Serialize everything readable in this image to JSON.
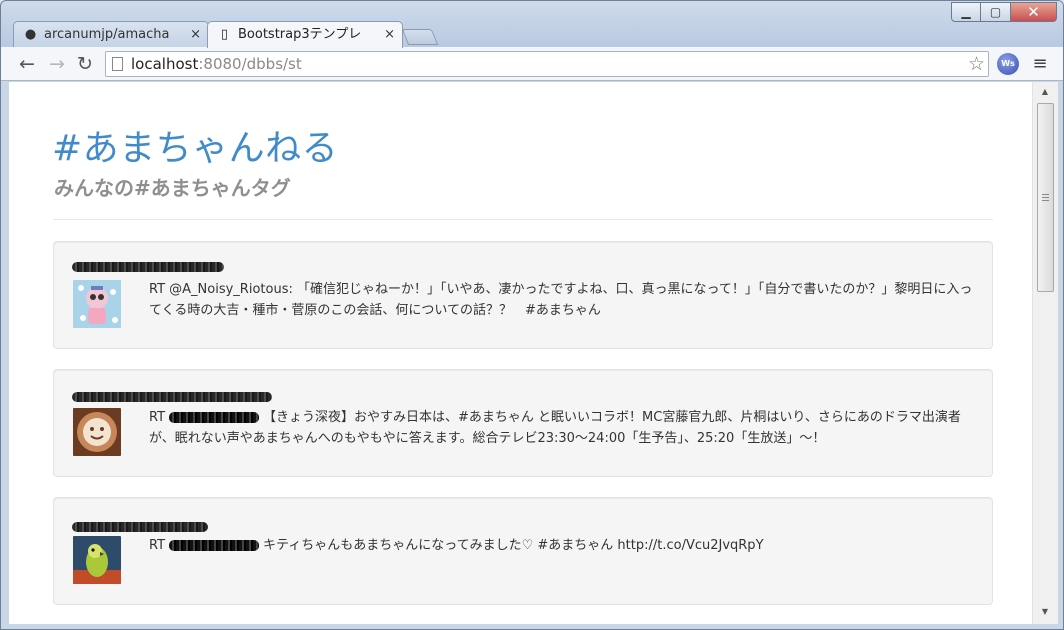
{
  "browser": {
    "tabs": [
      {
        "title": "arcanumjp/amacha",
        "favicon": "github-icon",
        "close": "×",
        "active": false
      },
      {
        "title": "Bootstrap3テンプレ",
        "favicon": "page-icon",
        "close": "×",
        "active": true
      }
    ],
    "url_host": "localhost",
    "url_rest": ":8080/dbbs/st",
    "extension_label": "Ws"
  },
  "page": {
    "title": "#あまちゃんねる",
    "subtitle": "みんなの#あまちゃんタグ"
  },
  "tweets": [
    {
      "prefix": "RT",
      "text": "RT @A_Noisy_Riotous: 「確信犯じゃねーか！」「いやあ、凄かったですよね、口、真っ黒になって！」「自分で書いたのか？」黎明日に入ってくる時の大吉・種市・菅原のこの会話、何についての話？？　#あまちゃん",
      "avatar": "avatar-cartoon-robot"
    },
    {
      "prefix": "RT",
      "text": "【きょう深夜】おやすみ日本は、#あまちゃん と眠いいコラボ！MC宮藤官九郎、片桐はいり、さらにあのドラマ出演者が、眠れない声やあまちゃんへのもやもやに答えます。総合テレビ23:30〜24:00「生予告」、25:20「生放送」〜！",
      "avatar": "avatar-latte-art"
    },
    {
      "prefix": "RT",
      "text": "キティちゃんもあまちゃんになってみました♡ #あまちゃん http://t.co/Vcu2JvqRpY",
      "avatar": "avatar-parrot"
    }
  ],
  "colors": {
    "title_blue": "#428bca",
    "well_bg": "#f5f5f5",
    "close_button_red": "#c75050"
  }
}
